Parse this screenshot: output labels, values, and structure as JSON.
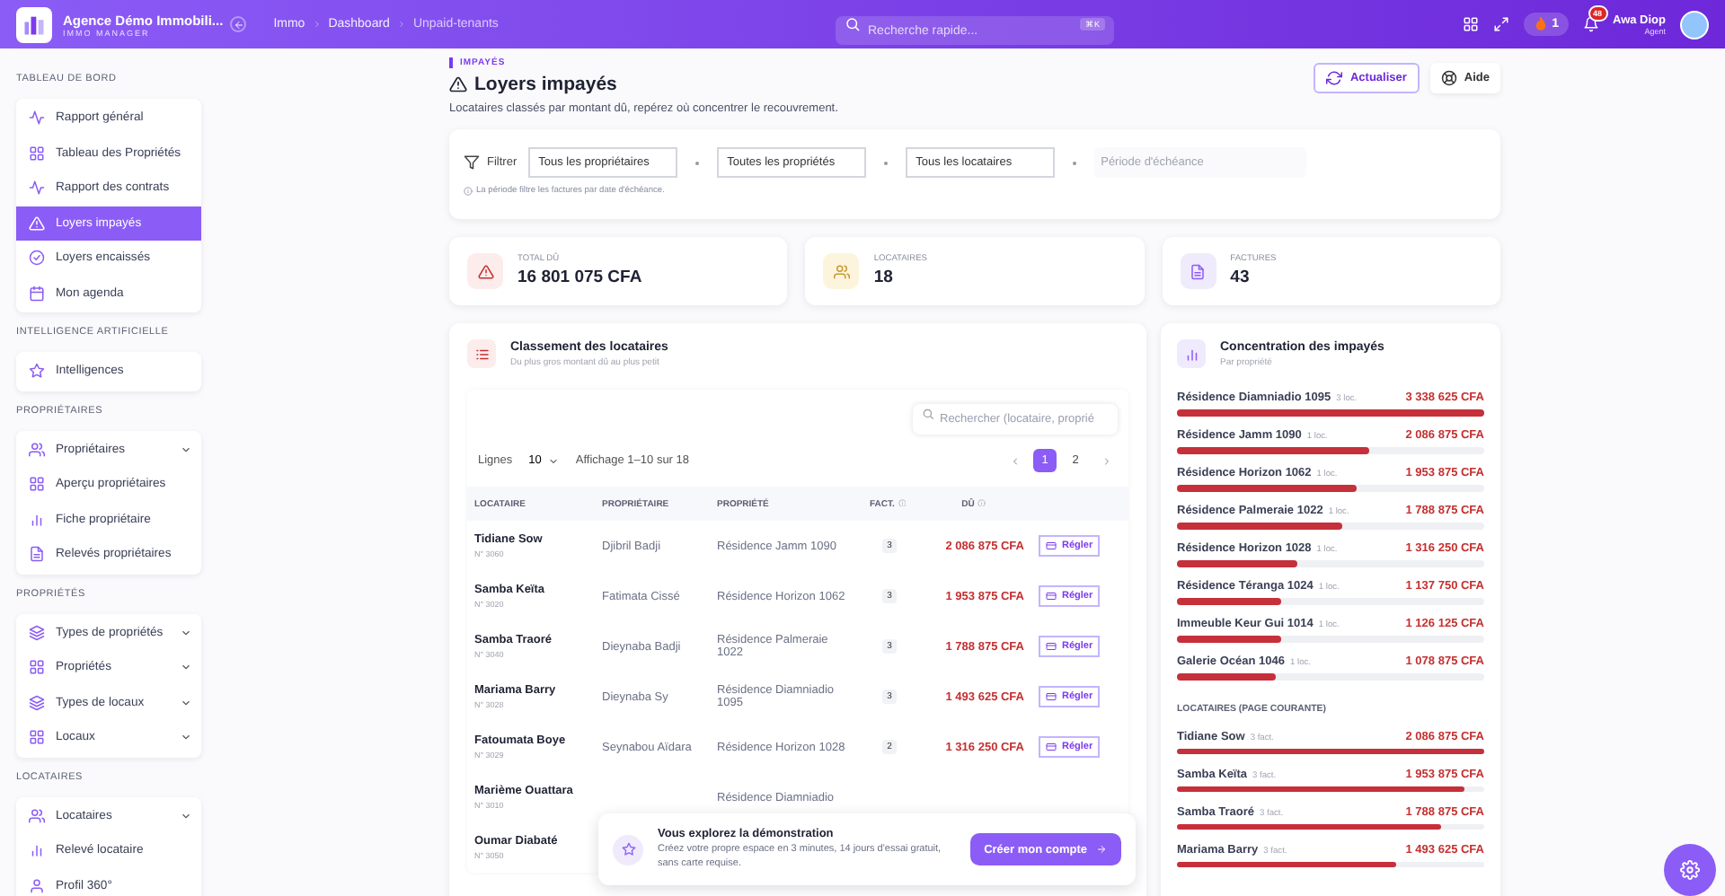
{
  "topbar": {
    "brand": {
      "name": "Agence Démo Immobili...",
      "subtitle": "IMMO MANAGER"
    },
    "breadcrumbs": [
      "Immo",
      "Dashboard",
      "Unpaid-tenants"
    ],
    "search": {
      "placeholder": "Recherche rapide...",
      "shortcut": "⌘K"
    },
    "streak": {
      "count": "1"
    },
    "notifications": {
      "count": "48"
    },
    "user": {
      "name": "Awa Diop",
      "role": "Agent"
    }
  },
  "sidebar": [
    {
      "title": "TABLEAU DE BORD",
      "items": [
        {
          "label": "Rapport général",
          "selected": false
        },
        {
          "label": "Tableau des Propriétés",
          "selected": false
        },
        {
          "label": "Rapport des contrats",
          "selected": false
        },
        {
          "label": "Loyers impayés",
          "selected": true
        },
        {
          "label": "Loyers encaissés",
          "selected": false
        },
        {
          "label": "Mon agenda",
          "selected": false
        }
      ]
    },
    {
      "title": "INTELLIGENCE ARTIFICIELLE",
      "items": [
        {
          "label": "Intelligences",
          "selected": false
        }
      ]
    },
    {
      "title": "PROPRIÉTAIRES",
      "items": [
        {
          "label": "Propriétaires",
          "selected": false,
          "expanded": false
        },
        {
          "label": "Aperçu propriétaires",
          "selected": false
        },
        {
          "label": "Fiche propriétaire",
          "selected": false
        },
        {
          "label": "Relevés propriétaires",
          "selected": false
        }
      ]
    },
    {
      "title": "PROPRIÉTÉS",
      "items": [
        {
          "label": "Types de propriétés",
          "selected": false,
          "expanded": false
        },
        {
          "label": "Propriétés",
          "selected": false,
          "expanded": false
        },
        {
          "label": "Types de locaux",
          "selected": false,
          "expanded": false
        },
        {
          "label": "Locaux",
          "selected": false,
          "expanded": false
        }
      ]
    },
    {
      "title": "LOCATAIRES",
      "items": [
        {
          "label": "Locataires",
          "selected": false,
          "expanded": false
        },
        {
          "label": "Relevé locataire",
          "selected": false
        },
        {
          "label": "Profil 360°",
          "selected": false
        }
      ]
    }
  ],
  "page": {
    "eyebrow": "IMPAYÉS",
    "title": "Loyers impayés",
    "subtitle": "Locataires classés par montant dû, repérez où concentrer le recouvrement.",
    "actions": [
      {
        "label": "Actualiser",
        "kind": "primary"
      },
      {
        "label": "Aide",
        "kind": "ghost"
      }
    ]
  },
  "filters": {
    "label": "Filtrer",
    "selects": [
      "Tous les propriétaires",
      "Toutes les propriétés",
      "Tous les locataires"
    ],
    "date": {
      "placeholder": "Période d'échéance"
    },
    "note": "La période filtre les factures par date d'échéance."
  },
  "stats": [
    {
      "label": "TOTAL DÛ",
      "value": "16 801 075 CFA"
    },
    {
      "label": "LOCATAIRES",
      "value": "18"
    },
    {
      "label": "FACTURES",
      "value": "43"
    }
  ],
  "ranking": {
    "title": "Classement des locataires",
    "subtitle": "Du plus gros montant dû au plus petit",
    "search": {
      "placeholder": "Rechercher (locataire, proprié"
    },
    "rows_label": "Lignes",
    "rows_per_page": "10",
    "showing": "Affichage 1–10 sur 18",
    "pages": [
      {
        "label": "1",
        "selected": true
      },
      {
        "label": "2",
        "selected": false
      }
    ],
    "columns": [
      "LOCATAIRE",
      "PROPRIÉTAIRE",
      "PROPRIÉTÉ",
      "FACT.",
      "DÛ"
    ],
    "rows": [
      {
        "tenant": "Tidiane Sow",
        "number": "N° 3060",
        "owner": "Djibril Badji",
        "property": "Résidence Jamm 1090",
        "invoices": "3",
        "due": "2 086 875 CFA",
        "action": "Régler"
      },
      {
        "tenant": "Samba Keïta",
        "number": "N° 3020",
        "owner": "Fatimata Cissé",
        "property": "Résidence Horizon 1062",
        "invoices": "3",
        "due": "1 953 875 CFA",
        "action": "Régler"
      },
      {
        "tenant": "Samba Traoré",
        "number": "N° 3040",
        "owner": "Dieynaba Badji",
        "property": "Résidence Palmeraie 1022",
        "invoices": "3",
        "due": "1 788 875 CFA",
        "action": "Régler"
      },
      {
        "tenant": "Mariama Barry",
        "number": "N° 3028",
        "owner": "Dieynaba Sy",
        "property": "Résidence Diamniadio 1095",
        "invoices": "3",
        "due": "1 493 625 CFA",
        "action": "Régler"
      },
      {
        "tenant": "Fatoumata Boye",
        "number": "N° 3029",
        "owner": "Seynabou Aïdara",
        "property": "Résidence Horizon 1028",
        "invoices": "2",
        "due": "1 316 250 CFA",
        "action": "Régler"
      },
      {
        "tenant": "Marième Ouattara",
        "number": "N° 3010",
        "property": "Résidence Diamniadio"
      },
      {
        "tenant": "Oumar Diabaté",
        "number": "N° 3050"
      }
    ]
  },
  "concentration": {
    "title": "Concentration des impayés",
    "subtitle": "Par propriété",
    "properties": [
      {
        "name": "Résidence Diamniadio 1095",
        "count": "3 loc.",
        "amount": "3 338 625 CFA",
        "level": 1
      },
      {
        "name": "Résidence Jamm 1090",
        "count": "1 loc.",
        "amount": "2 086 875 CFA",
        "level": 0.625
      },
      {
        "name": "Résidence Horizon 1062",
        "count": "1 loc.",
        "amount": "1 953 875 CFA",
        "level": 0.585
      },
      {
        "name": "Résidence Palmeraie 1022",
        "count": "1 loc.",
        "amount": "1 788 875 CFA",
        "level": 0.536
      },
      {
        "name": "Résidence Horizon 1028",
        "count": "1 loc.",
        "amount": "1 316 250 CFA",
        "level": 0.394
      },
      {
        "name": "Résidence Téranga 1024",
        "count": "1 loc.",
        "amount": "1 137 750 CFA",
        "level": 0.341
      },
      {
        "name": "Immeuble Keur Gui 1014",
        "count": "1 loc.",
        "amount": "1 126 125 CFA",
        "level": 0.337
      },
      {
        "name": "Galerie Océan 1046",
        "count": "1 loc.",
        "amount": "1 078 875 CFA",
        "level": 0.323
      }
    ],
    "tenants_title": "LOCATAIRES (PAGE COURANTE)",
    "tenants": [
      {
        "name": "Tidiane Sow",
        "count": "3 fact.",
        "amount": "2 086 875 CFA",
        "level": 1
      },
      {
        "name": "Samba Keïta",
        "count": "3 fact.",
        "amount": "1 953 875 CFA",
        "level": 0.936
      },
      {
        "name": "Samba Traoré",
        "count": "3 fact.",
        "amount": "1 788 875 CFA",
        "level": 0.857
      },
      {
        "name": "Mariama Barry",
        "count": "3 fact.",
        "amount": "1 493 625 CFA",
        "level": 0.716
      }
    ]
  },
  "demo_banner": {
    "title": "Vous explorez la démonstration",
    "text": "Créez votre propre espace en 3 minutes, 14 jours d'essai gratuit, sans carte requise.",
    "button": "Créer mon compte"
  }
}
